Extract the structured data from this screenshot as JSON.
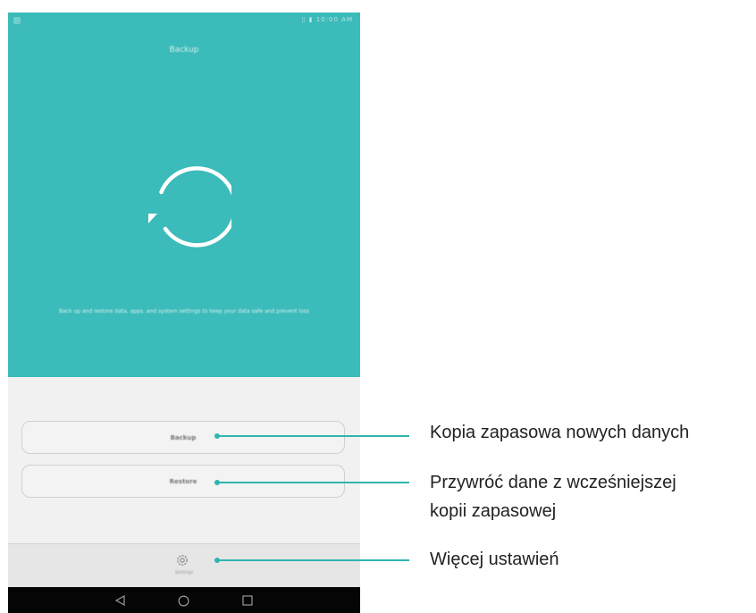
{
  "app": {
    "title": "Backup",
    "description": "Back up and restore data, apps, and system settings to keep your data safe and prevent loss"
  },
  "status_bar": {
    "right_text": "▯ ▮ 10:00 AM"
  },
  "buttons": {
    "backup": "Backup",
    "restore": "Restore"
  },
  "bottom": {
    "settings_label": "Settings",
    "settings_icon": "gear-icon"
  },
  "navbar": {
    "back_icon": "back-triangle-icon",
    "home_icon": "home-circle-icon",
    "recents_icon": "recents-square-icon"
  },
  "callouts": [
    {
      "text": "Kopia zapasowa nowych danych"
    },
    {
      "line1": "Przywróć dane z wcześniejszej",
      "line2": "kopii zapasowej"
    },
    {
      "text": "Więcej ustawień"
    }
  ],
  "colors": {
    "hero": "#3bbbb9",
    "callout": "#2fb5b0",
    "navbar": "#050505"
  }
}
